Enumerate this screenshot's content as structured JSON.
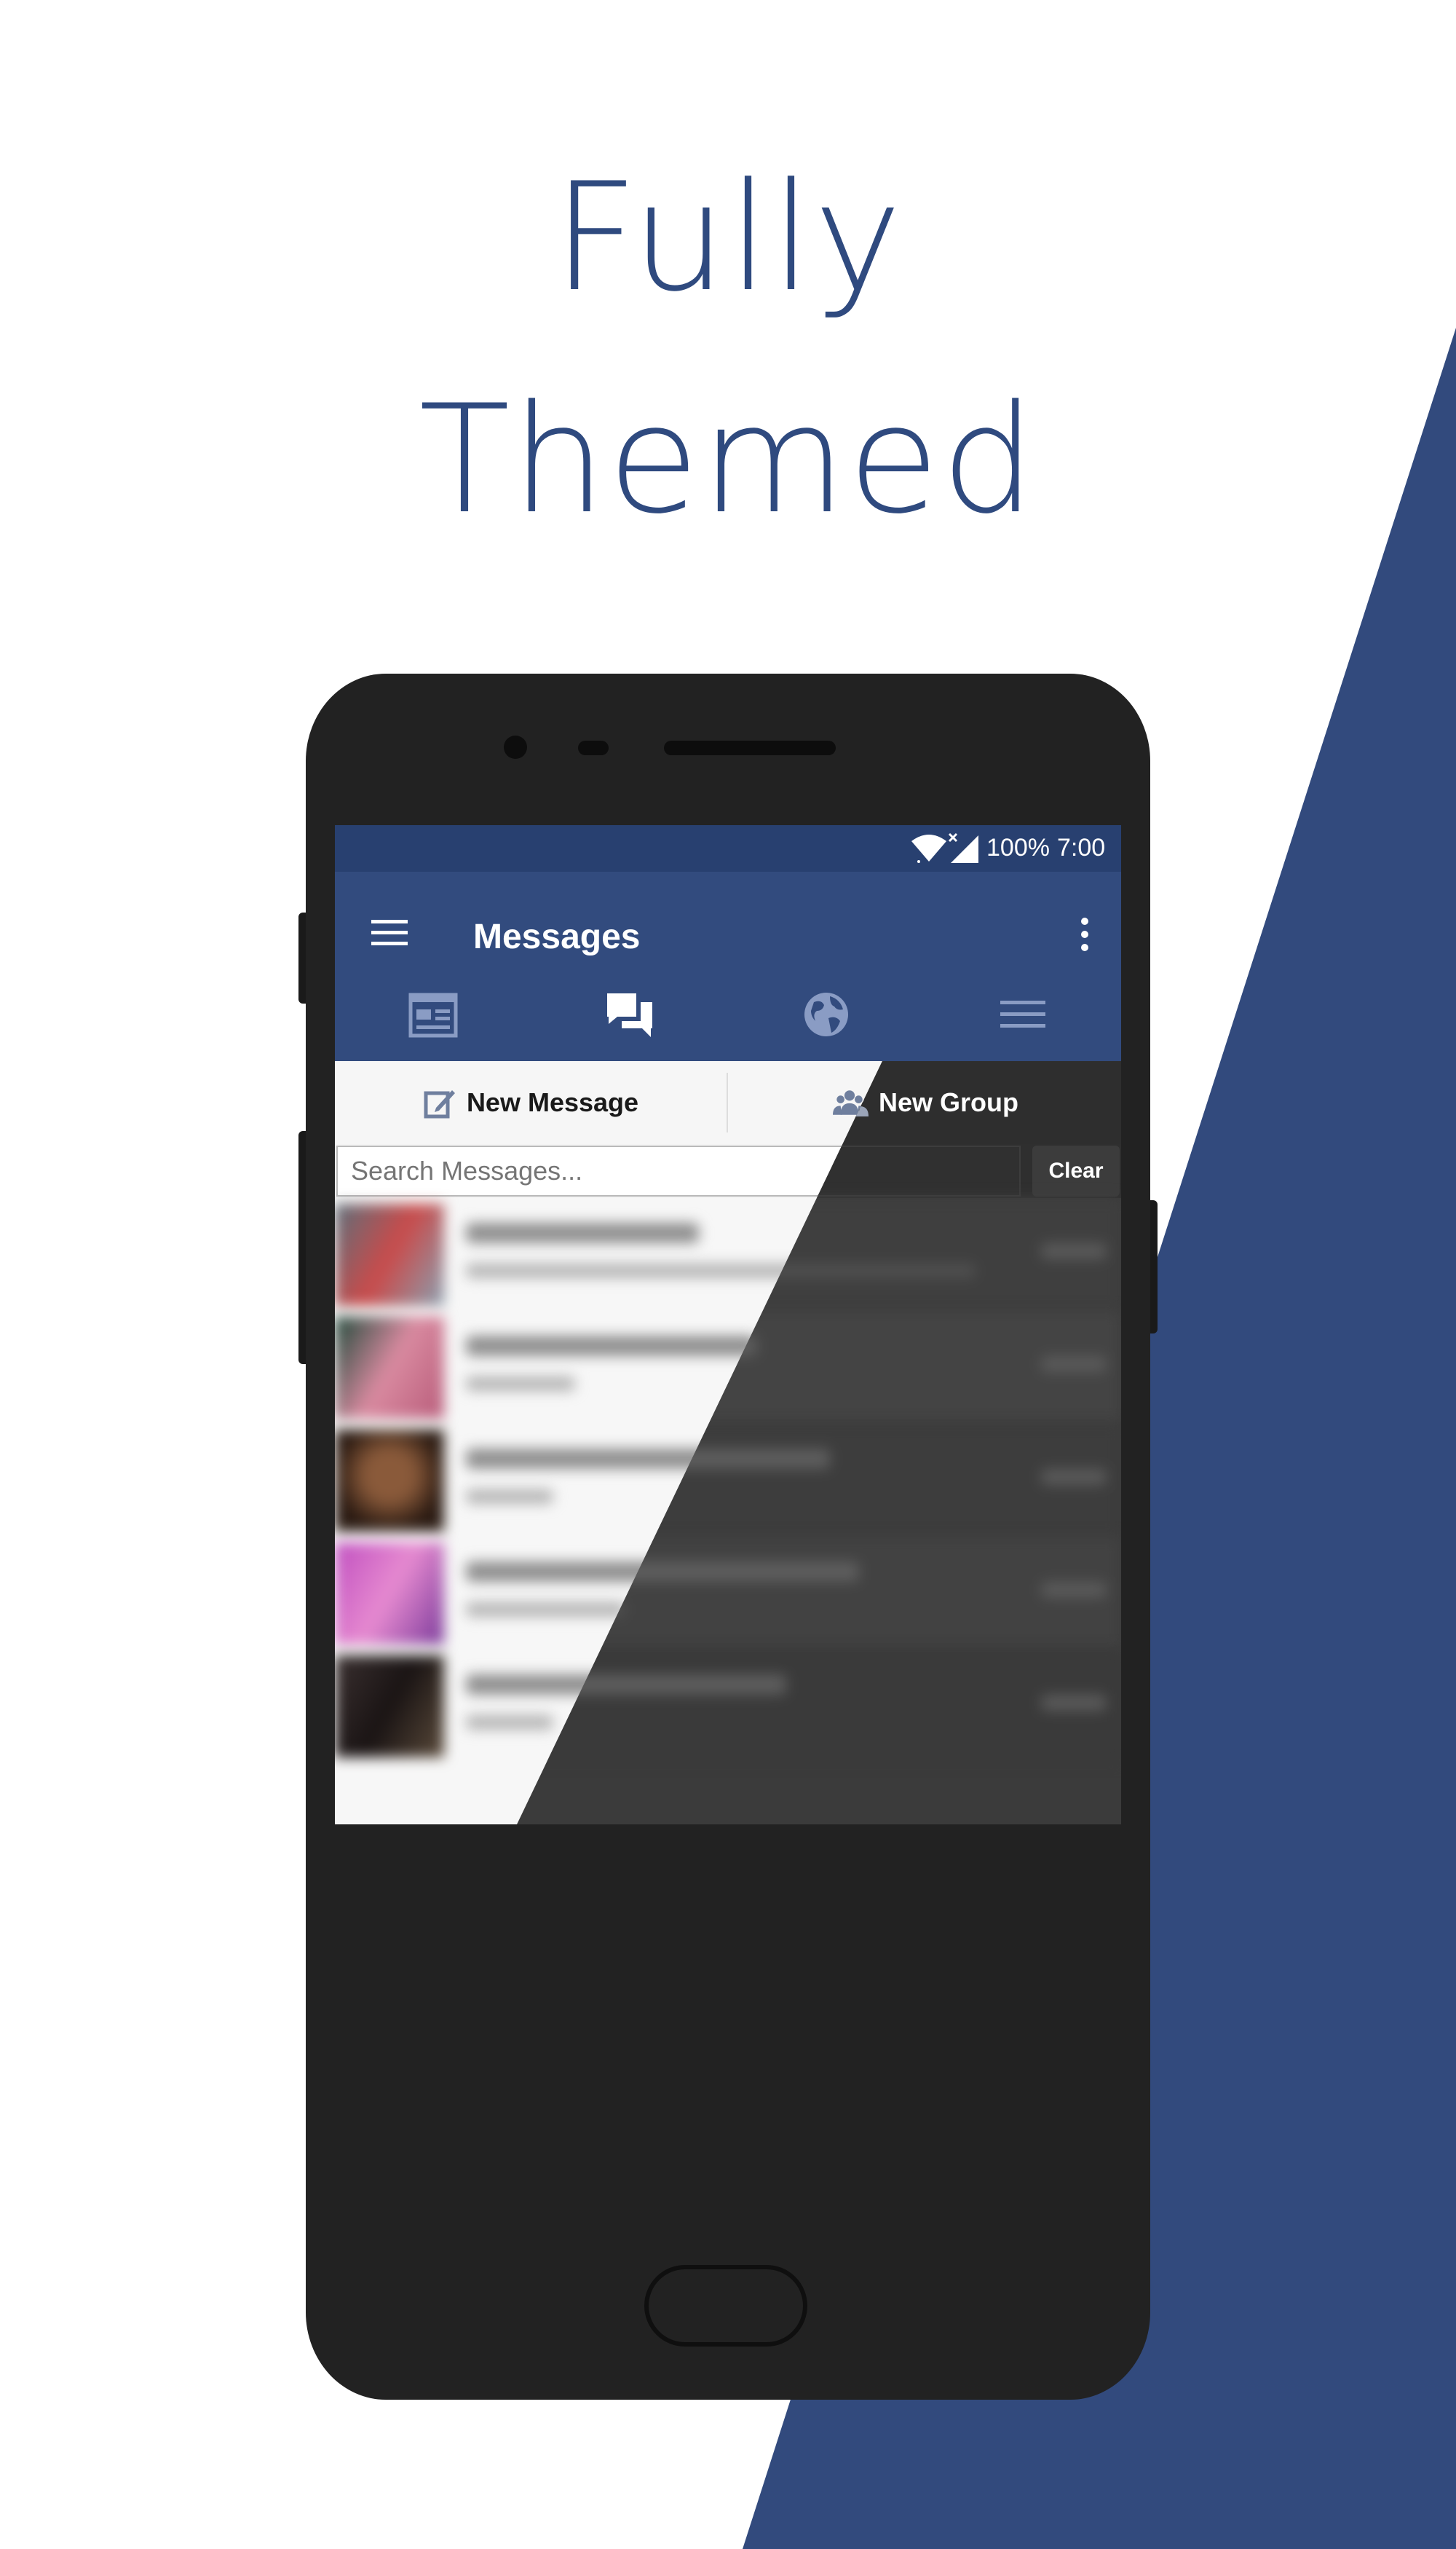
{
  "headline": {
    "line1": "Fully",
    "line2": "Themed"
  },
  "colors": {
    "brand": "#324b7e",
    "status_bar": "#284070",
    "headline": "#2f4a7f",
    "phone_body": "#222222",
    "dark_theme": "#3b3b3b"
  },
  "status_bar": {
    "battery": "100%",
    "time": "7:00",
    "icons": [
      "wifi-icon",
      "signal-icon"
    ]
  },
  "toolbar": {
    "title": "Messages",
    "icons": [
      "menu-icon",
      "overflow-menu-icon"
    ]
  },
  "tabs": [
    {
      "icon": "news-feed-icon",
      "active": false
    },
    {
      "icon": "messages-icon",
      "active": true
    },
    {
      "icon": "globe-icon",
      "active": false
    },
    {
      "icon": "menu-lines-icon",
      "active": false
    }
  ],
  "actions": {
    "new_message": "New Message",
    "new_group": "New Group"
  },
  "search": {
    "placeholder": "Search Messages...",
    "clear_label": "Clear"
  }
}
